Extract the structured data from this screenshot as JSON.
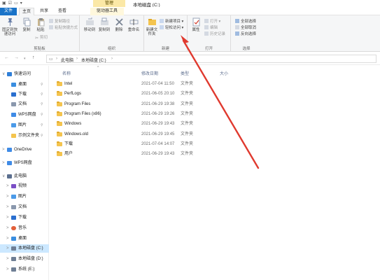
{
  "titlebar": {
    "context_tab": "管理",
    "window_title": "本地磁盘 (C:)"
  },
  "tabs": {
    "file": "文件",
    "home": "主页",
    "share": "共享",
    "view": "查看",
    "drive_tools": "驱动器工具"
  },
  "ribbon": {
    "clipboard": {
      "pin_quick_access": "固定到快速访问",
      "copy": "复制",
      "paste": "粘贴",
      "copy_path": "复制路径",
      "paste_shortcut": "粘贴快捷方式",
      "cut": "剪切",
      "label": "剪贴板"
    },
    "organize": {
      "move_to": "移动到",
      "copy_to": "复制到",
      "delete": "删除",
      "rename": "重命名",
      "label": "组织"
    },
    "new": {
      "new_folder": "新建文件夹",
      "new_item": "新建项目",
      "easy_access": "轻松访问",
      "label": "新建"
    },
    "open": {
      "properties": "属性",
      "open": "打开",
      "edit": "编辑",
      "history": "历史记录",
      "label": "打开"
    },
    "select": {
      "select_all": "全部选择",
      "select_none": "全部取消",
      "invert": "反向选择",
      "label": "选择"
    }
  },
  "address": {
    "this_pc": "此电脑",
    "drive": "本地磁盘 (C:)"
  },
  "sidebar": {
    "items": [
      {
        "label": "快速访问",
        "type": "star"
      },
      {
        "label": "桌面",
        "type": "desktop"
      },
      {
        "label": "下载",
        "type": "download"
      },
      {
        "label": "文档",
        "type": "doc"
      },
      {
        "label": "WPS网盘",
        "type": "cloud"
      },
      {
        "label": "图片",
        "type": "pic"
      },
      {
        "label": "示例文件夹",
        "type": "folder"
      },
      {
        "label": "OneDrive",
        "type": "cloud"
      },
      {
        "label": "WPS网盘",
        "type": "cloud"
      },
      {
        "label": "此电脑",
        "type": "pc"
      },
      {
        "label": "视频",
        "type": "video"
      },
      {
        "label": "图片",
        "type": "pic"
      },
      {
        "label": "文档",
        "type": "doc"
      },
      {
        "label": "下载",
        "type": "download"
      },
      {
        "label": "音乐",
        "type": "music"
      },
      {
        "label": "桌面",
        "type": "desktop"
      },
      {
        "label": "本地磁盘 (C:)",
        "type": "drive"
      },
      {
        "label": "本地磁盘 (D:)",
        "type": "drive"
      },
      {
        "label": "系统 (E:)",
        "type": "drive"
      }
    ]
  },
  "columns": {
    "name": "名称",
    "date": "修改日期",
    "type": "类型",
    "size": "大小"
  },
  "files": [
    {
      "name": "Intel",
      "date": "2021-07-04 11:50",
      "type": "文件夹"
    },
    {
      "name": "PerfLogs",
      "date": "2021-06-05 20:10",
      "type": "文件夹"
    },
    {
      "name": "Program Files",
      "date": "2021-06-29 19:38",
      "type": "文件夹"
    },
    {
      "name": "Program Files (x86)",
      "date": "2021-06-29 19:26",
      "type": "文件夹"
    },
    {
      "name": "Windows",
      "date": "2021-06-29 19:43",
      "type": "文件夹"
    },
    {
      "name": "Windows.old",
      "date": "2021-06-29 19:45",
      "type": "文件夹"
    },
    {
      "name": "下载",
      "date": "2021-07-04 14:07",
      "type": "文件夹"
    },
    {
      "name": "用户",
      "date": "2021-06-29 19:43",
      "type": "文件夹"
    }
  ],
  "colors": {
    "accent": "#1a73c8",
    "annotation": "#e03a2f",
    "folder": "#f4c44e",
    "selected": "#cce8ff"
  }
}
